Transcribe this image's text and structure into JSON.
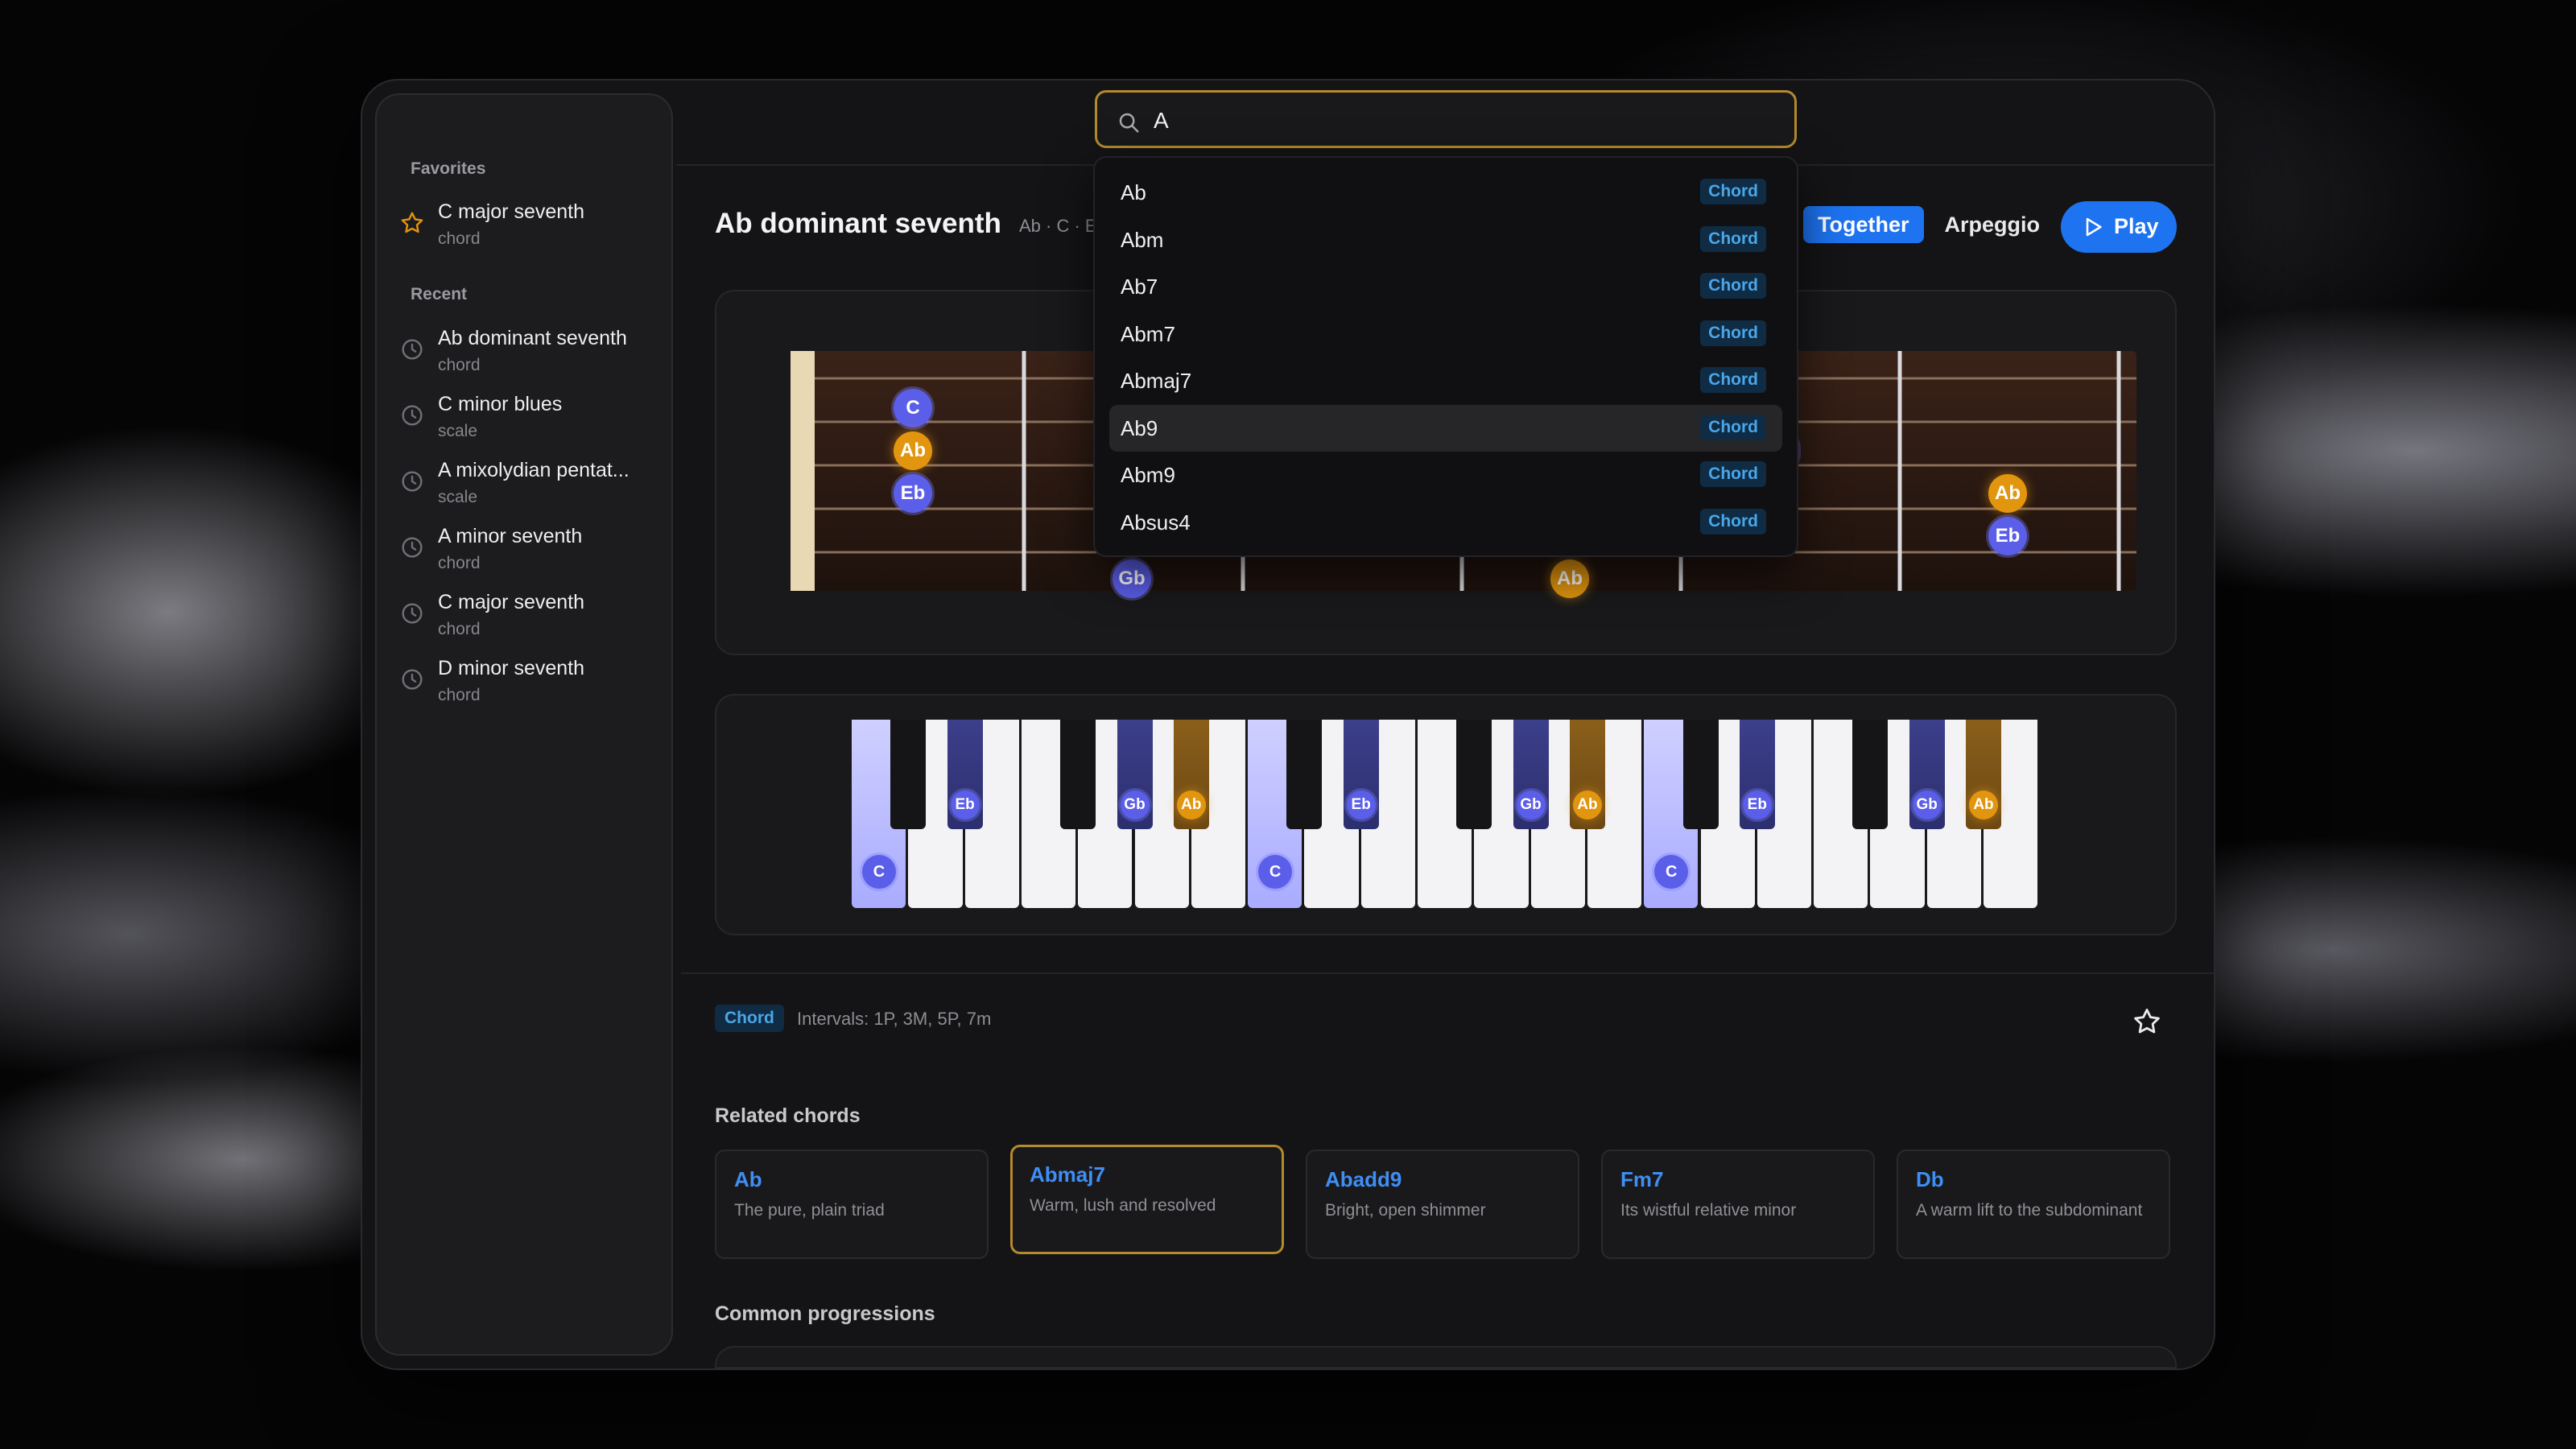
{
  "colors": {
    "accent_blue": "#1d73f0",
    "note_blue": "#5b5ee8",
    "note_gold": "#e2950f",
    "search_border": "#b48a2c",
    "tag_text": "#4aa6e8"
  },
  "sidebar": {
    "favorites_label": "Favorites",
    "favorites": [
      {
        "title": "C major seventh",
        "type": "chord",
        "icon": "star-icon"
      }
    ],
    "recent_label": "Recent",
    "recent": [
      {
        "title": "Ab dominant seventh",
        "type": "chord",
        "icon": "clock-icon"
      },
      {
        "title": "C minor blues",
        "type": "scale",
        "icon": "clock-icon"
      },
      {
        "title": "A mixolydian pentat...",
        "type": "scale",
        "icon": "clock-icon"
      },
      {
        "title": "A minor seventh",
        "type": "chord",
        "icon": "clock-icon"
      },
      {
        "title": "C major seventh",
        "type": "chord",
        "icon": "clock-icon"
      },
      {
        "title": "D minor seventh",
        "type": "chord",
        "icon": "clock-icon"
      }
    ]
  },
  "search": {
    "value": "A",
    "icon": "search-icon"
  },
  "dropdown": [
    {
      "label": "Ab",
      "tag": "Chord"
    },
    {
      "label": "Abm",
      "tag": "Chord"
    },
    {
      "label": "Ab7",
      "tag": "Chord"
    },
    {
      "label": "Abm7",
      "tag": "Chord"
    },
    {
      "label": "Abmaj7",
      "tag": "Chord"
    },
    {
      "label": "Ab9",
      "tag": "Chord",
      "active": true
    },
    {
      "label": "Abm9",
      "tag": "Chord"
    },
    {
      "label": "Absus4",
      "tag": "Chord"
    }
  ],
  "header": {
    "title": "Ab dominant seventh",
    "subtitle": "Ab · C · E",
    "mode_options": [
      "Together",
      "Arpeggio"
    ],
    "selected_mode": "Together",
    "play_label": "Play"
  },
  "fretboard": {
    "notes": [
      "C",
      "Ab",
      "Eb",
      "Gb",
      "Ab",
      "Ab",
      "Eb"
    ]
  },
  "piano": {
    "white_notes": [
      "C",
      "C",
      "C"
    ],
    "black_notes": [
      "Eb",
      "Gb",
      "Ab",
      "Eb",
      "Gb",
      "Ab",
      "Eb",
      "Gb",
      "Ab"
    ]
  },
  "info": {
    "badge": "Chord",
    "intervals": "Intervals: 1P, 3M, 5P, 7m",
    "favorite_icon": "star-outline-icon"
  },
  "related": {
    "heading": "Related chords",
    "items": [
      {
        "name": "Ab",
        "desc": "The pure, plain triad"
      },
      {
        "name": "Abmaj7",
        "desc": "Warm, lush and resolved",
        "selected": true
      },
      {
        "name": "Abadd9",
        "desc": "Bright, open shimmer"
      },
      {
        "name": "Fm7",
        "desc": "Its wistful relative minor"
      },
      {
        "name": "Db",
        "desc": "A warm lift to the subdominant"
      }
    ]
  },
  "progressions": {
    "heading": "Common progressions"
  }
}
